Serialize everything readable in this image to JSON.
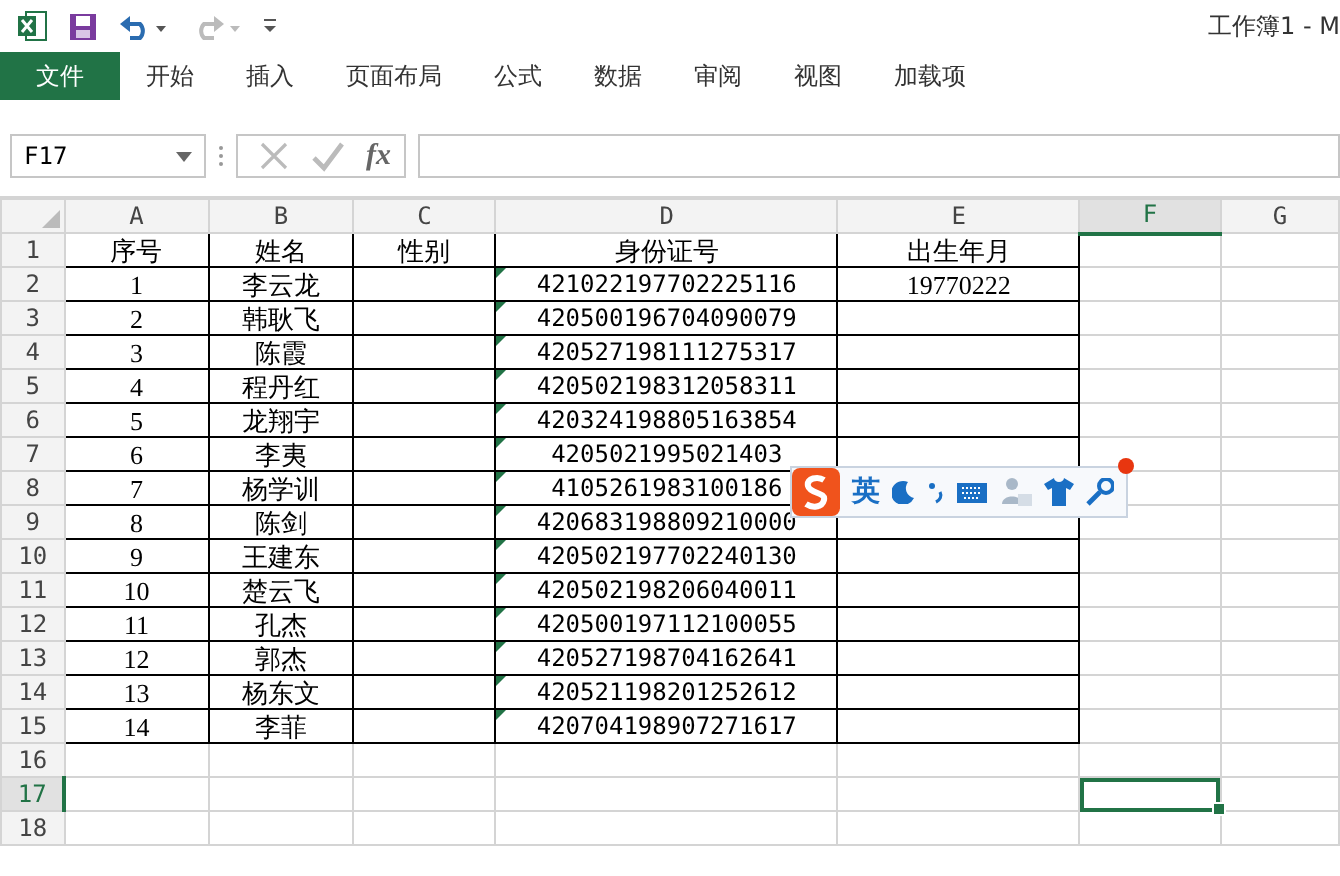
{
  "title_bar": {
    "title": "工作簿1 - M"
  },
  "ribbon_tabs": [
    {
      "label": "文件",
      "kind": "file"
    },
    {
      "label": "开始",
      "kind": "tab"
    },
    {
      "label": "插入",
      "kind": "tab"
    },
    {
      "label": "页面布局",
      "kind": "tab"
    },
    {
      "label": "公式",
      "kind": "tab"
    },
    {
      "label": "数据",
      "kind": "tab"
    },
    {
      "label": "审阅",
      "kind": "tab"
    },
    {
      "label": "视图",
      "kind": "tab"
    },
    {
      "label": "加载项",
      "kind": "tab"
    }
  ],
  "formula_bar": {
    "name_box": "F17",
    "function_button": "fx"
  },
  "sheet": {
    "columns": [
      {
        "label": "A",
        "selected": false
      },
      {
        "label": "B",
        "selected": false
      },
      {
        "label": "C",
        "selected": false
      },
      {
        "label": "D",
        "selected": false
      },
      {
        "label": "E",
        "selected": false
      },
      {
        "label": "F",
        "selected": true
      },
      {
        "label": "G",
        "selected": false
      }
    ],
    "rows": [
      {
        "label": "1",
        "selected": false,
        "bordered": true,
        "flagged": false,
        "cells": [
          "序号",
          "姓名",
          "性别",
          "身份证号",
          "出生年月"
        ]
      },
      {
        "label": "2",
        "selected": false,
        "bordered": true,
        "flagged": true,
        "cells": [
          "1",
          "李云龙",
          "",
          "421022197702225116",
          "19770222"
        ]
      },
      {
        "label": "3",
        "selected": false,
        "bordered": true,
        "flagged": true,
        "cells": [
          "2",
          "韩耿飞",
          "",
          "420500196704090079"
        ]
      },
      {
        "label": "4",
        "selected": false,
        "bordered": true,
        "flagged": true,
        "cells": [
          "3",
          "陈霞",
          "",
          "420527198111275317"
        ]
      },
      {
        "label": "5",
        "selected": false,
        "bordered": true,
        "flagged": true,
        "cells": [
          "4",
          "程丹红",
          "",
          "420502198312058311"
        ]
      },
      {
        "label": "6",
        "selected": false,
        "bordered": true,
        "flagged": true,
        "cells": [
          "5",
          "龙翔宇",
          "",
          "420324198805163854"
        ]
      },
      {
        "label": "7",
        "selected": false,
        "bordered": true,
        "flagged": true,
        "cells": [
          "6",
          "李夷",
          "",
          "4205021995021403"
        ]
      },
      {
        "label": "8",
        "selected": false,
        "bordered": true,
        "flagged": true,
        "cells": [
          "7",
          "杨学训",
          "",
          "4105261983100186"
        ]
      },
      {
        "label": "9",
        "selected": false,
        "bordered": true,
        "flagged": true,
        "cells": [
          "8",
          "陈剑",
          "",
          "420683198809210000"
        ]
      },
      {
        "label": "10",
        "selected": false,
        "bordered": true,
        "flagged": true,
        "cells": [
          "9",
          "王建东",
          "",
          "420502197702240130"
        ]
      },
      {
        "label": "11",
        "selected": false,
        "bordered": true,
        "flagged": true,
        "cells": [
          "10",
          "楚云飞",
          "",
          "420502198206040011"
        ]
      },
      {
        "label": "12",
        "selected": false,
        "bordered": true,
        "flagged": true,
        "cells": [
          "11",
          "孔杰",
          "",
          "420500197112100055"
        ]
      },
      {
        "label": "13",
        "selected": false,
        "bordered": true,
        "flagged": true,
        "cells": [
          "12",
          "郭杰",
          "",
          "420527198704162641"
        ]
      },
      {
        "label": "14",
        "selected": false,
        "bordered": true,
        "flagged": true,
        "cells": [
          "13",
          "杨东文",
          "",
          "420521198201252612"
        ]
      },
      {
        "label": "15",
        "selected": false,
        "bordered": true,
        "flagged": true,
        "cells": [
          "14",
          "李菲",
          "",
          "420704198907271617"
        ]
      },
      {
        "label": "16",
        "selected": false,
        "bordered": false,
        "flagged": false,
        "cells": []
      },
      {
        "label": "17",
        "selected": true,
        "bordered": false,
        "flagged": false,
        "cells": []
      },
      {
        "label": "18",
        "selected": false,
        "bordered": false,
        "flagged": false,
        "cells": []
      }
    ]
  },
  "ime_toolbar": {
    "language": "英"
  }
}
